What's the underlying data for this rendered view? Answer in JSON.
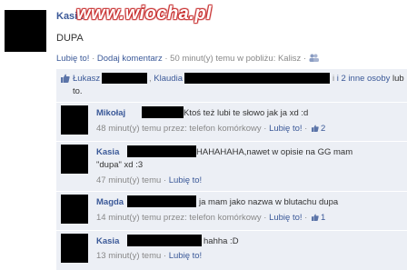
{
  "post": {
    "author": "Kasia",
    "text": "DUPA",
    "actions": {
      "like": "Lubię to!",
      "sep1": "·",
      "comment": "Dodaj komentarz",
      "sep2": "·",
      "meta": "50 minut(y) temu w pobliżu: Kalisz",
      "sep3": "·"
    },
    "watermark": "www.wiocha.pl"
  },
  "likes": {
    "name1": "Łukasz",
    "name2": "Klaudia",
    "others": "i 2 inne osoby",
    "suffix_tail": "lub",
    "line2": "to."
  },
  "comments": [
    {
      "author": "Mikołaj",
      "text": "Ktoś też lubi te słowo jak ja xd :d",
      "time": "48 minut(y) temu przez: telefon komórkowy",
      "sep": "·",
      "like": "Lubię to!",
      "sep2": "·",
      "likes_count": "2"
    },
    {
      "author": "Kasia",
      "text": "HAHAHAHA,nawet w opisie na GG mam",
      "text2": "\"dupa\" xd :3",
      "time": "47 minut(y) temu",
      "sep": "·",
      "like": "Lubię to!"
    },
    {
      "author": "Magda",
      "text": "ja mam jako nazwa w blutachu dupa",
      "time": "14 minut(y) temu przez: telefon komórkowy",
      "sep": "·",
      "like": "Lubię to!",
      "sep2": "·",
      "likes_count": "1"
    },
    {
      "author": "Kasia",
      "text": "hahha :D",
      "time": "13 minut(y) temu",
      "sep": "·",
      "like": "Lubię to!"
    }
  ]
}
